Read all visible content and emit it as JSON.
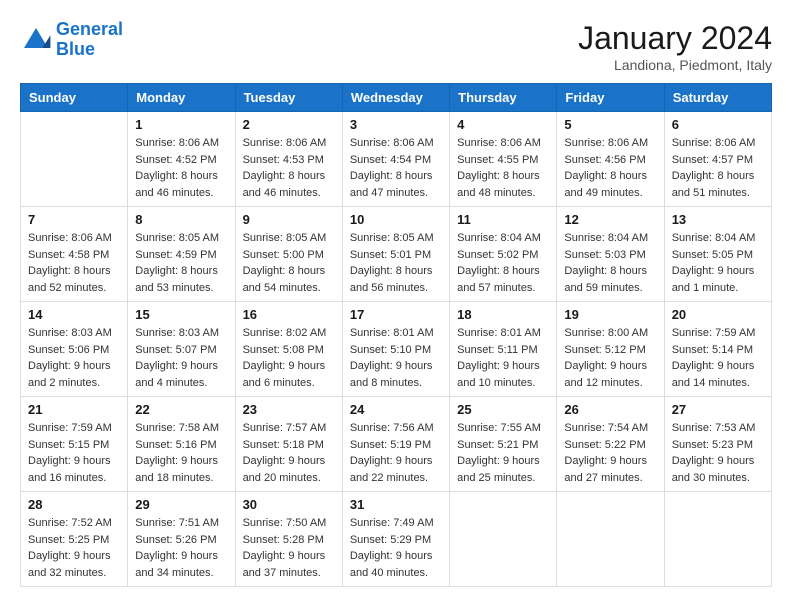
{
  "logo": {
    "line1": "General",
    "line2": "Blue"
  },
  "header": {
    "month": "January 2024",
    "location": "Landiona, Piedmont, Italy"
  },
  "weekdays": [
    "Sunday",
    "Monday",
    "Tuesday",
    "Wednesday",
    "Thursday",
    "Friday",
    "Saturday"
  ],
  "weeks": [
    [
      {
        "day": "",
        "sunrise": "",
        "sunset": "",
        "daylight": "",
        "empty": true
      },
      {
        "day": "1",
        "sunrise": "Sunrise: 8:06 AM",
        "sunset": "Sunset: 4:52 PM",
        "daylight": "Daylight: 8 hours and 46 minutes."
      },
      {
        "day": "2",
        "sunrise": "Sunrise: 8:06 AM",
        "sunset": "Sunset: 4:53 PM",
        "daylight": "Daylight: 8 hours and 46 minutes."
      },
      {
        "day": "3",
        "sunrise": "Sunrise: 8:06 AM",
        "sunset": "Sunset: 4:54 PM",
        "daylight": "Daylight: 8 hours and 47 minutes."
      },
      {
        "day": "4",
        "sunrise": "Sunrise: 8:06 AM",
        "sunset": "Sunset: 4:55 PM",
        "daylight": "Daylight: 8 hours and 48 minutes."
      },
      {
        "day": "5",
        "sunrise": "Sunrise: 8:06 AM",
        "sunset": "Sunset: 4:56 PM",
        "daylight": "Daylight: 8 hours and 49 minutes."
      },
      {
        "day": "6",
        "sunrise": "Sunrise: 8:06 AM",
        "sunset": "Sunset: 4:57 PM",
        "daylight": "Daylight: 8 hours and 51 minutes."
      }
    ],
    [
      {
        "day": "7",
        "sunrise": "Sunrise: 8:06 AM",
        "sunset": "Sunset: 4:58 PM",
        "daylight": "Daylight: 8 hours and 52 minutes."
      },
      {
        "day": "8",
        "sunrise": "Sunrise: 8:05 AM",
        "sunset": "Sunset: 4:59 PM",
        "daylight": "Daylight: 8 hours and 53 minutes."
      },
      {
        "day": "9",
        "sunrise": "Sunrise: 8:05 AM",
        "sunset": "Sunset: 5:00 PM",
        "daylight": "Daylight: 8 hours and 54 minutes."
      },
      {
        "day": "10",
        "sunrise": "Sunrise: 8:05 AM",
        "sunset": "Sunset: 5:01 PM",
        "daylight": "Daylight: 8 hours and 56 minutes."
      },
      {
        "day": "11",
        "sunrise": "Sunrise: 8:04 AM",
        "sunset": "Sunset: 5:02 PM",
        "daylight": "Daylight: 8 hours and 57 minutes."
      },
      {
        "day": "12",
        "sunrise": "Sunrise: 8:04 AM",
        "sunset": "Sunset: 5:03 PM",
        "daylight": "Daylight: 8 hours and 59 minutes."
      },
      {
        "day": "13",
        "sunrise": "Sunrise: 8:04 AM",
        "sunset": "Sunset: 5:05 PM",
        "daylight": "Daylight: 9 hours and 1 minute."
      }
    ],
    [
      {
        "day": "14",
        "sunrise": "Sunrise: 8:03 AM",
        "sunset": "Sunset: 5:06 PM",
        "daylight": "Daylight: 9 hours and 2 minutes."
      },
      {
        "day": "15",
        "sunrise": "Sunrise: 8:03 AM",
        "sunset": "Sunset: 5:07 PM",
        "daylight": "Daylight: 9 hours and 4 minutes."
      },
      {
        "day": "16",
        "sunrise": "Sunrise: 8:02 AM",
        "sunset": "Sunset: 5:08 PM",
        "daylight": "Daylight: 9 hours and 6 minutes."
      },
      {
        "day": "17",
        "sunrise": "Sunrise: 8:01 AM",
        "sunset": "Sunset: 5:10 PM",
        "daylight": "Daylight: 9 hours and 8 minutes."
      },
      {
        "day": "18",
        "sunrise": "Sunrise: 8:01 AM",
        "sunset": "Sunset: 5:11 PM",
        "daylight": "Daylight: 9 hours and 10 minutes."
      },
      {
        "day": "19",
        "sunrise": "Sunrise: 8:00 AM",
        "sunset": "Sunset: 5:12 PM",
        "daylight": "Daylight: 9 hours and 12 minutes."
      },
      {
        "day": "20",
        "sunrise": "Sunrise: 7:59 AM",
        "sunset": "Sunset: 5:14 PM",
        "daylight": "Daylight: 9 hours and 14 minutes."
      }
    ],
    [
      {
        "day": "21",
        "sunrise": "Sunrise: 7:59 AM",
        "sunset": "Sunset: 5:15 PM",
        "daylight": "Daylight: 9 hours and 16 minutes."
      },
      {
        "day": "22",
        "sunrise": "Sunrise: 7:58 AM",
        "sunset": "Sunset: 5:16 PM",
        "daylight": "Daylight: 9 hours and 18 minutes."
      },
      {
        "day": "23",
        "sunrise": "Sunrise: 7:57 AM",
        "sunset": "Sunset: 5:18 PM",
        "daylight": "Daylight: 9 hours and 20 minutes."
      },
      {
        "day": "24",
        "sunrise": "Sunrise: 7:56 AM",
        "sunset": "Sunset: 5:19 PM",
        "daylight": "Daylight: 9 hours and 22 minutes."
      },
      {
        "day": "25",
        "sunrise": "Sunrise: 7:55 AM",
        "sunset": "Sunset: 5:21 PM",
        "daylight": "Daylight: 9 hours and 25 minutes."
      },
      {
        "day": "26",
        "sunrise": "Sunrise: 7:54 AM",
        "sunset": "Sunset: 5:22 PM",
        "daylight": "Daylight: 9 hours and 27 minutes."
      },
      {
        "day": "27",
        "sunrise": "Sunrise: 7:53 AM",
        "sunset": "Sunset: 5:23 PM",
        "daylight": "Daylight: 9 hours and 30 minutes."
      }
    ],
    [
      {
        "day": "28",
        "sunrise": "Sunrise: 7:52 AM",
        "sunset": "Sunset: 5:25 PM",
        "daylight": "Daylight: 9 hours and 32 minutes."
      },
      {
        "day": "29",
        "sunrise": "Sunrise: 7:51 AM",
        "sunset": "Sunset: 5:26 PM",
        "daylight": "Daylight: 9 hours and 34 minutes."
      },
      {
        "day": "30",
        "sunrise": "Sunrise: 7:50 AM",
        "sunset": "Sunset: 5:28 PM",
        "daylight": "Daylight: 9 hours and 37 minutes."
      },
      {
        "day": "31",
        "sunrise": "Sunrise: 7:49 AM",
        "sunset": "Sunset: 5:29 PM",
        "daylight": "Daylight: 9 hours and 40 minutes."
      },
      {
        "day": "",
        "empty": true
      },
      {
        "day": "",
        "empty": true
      },
      {
        "day": "",
        "empty": true
      }
    ]
  ]
}
